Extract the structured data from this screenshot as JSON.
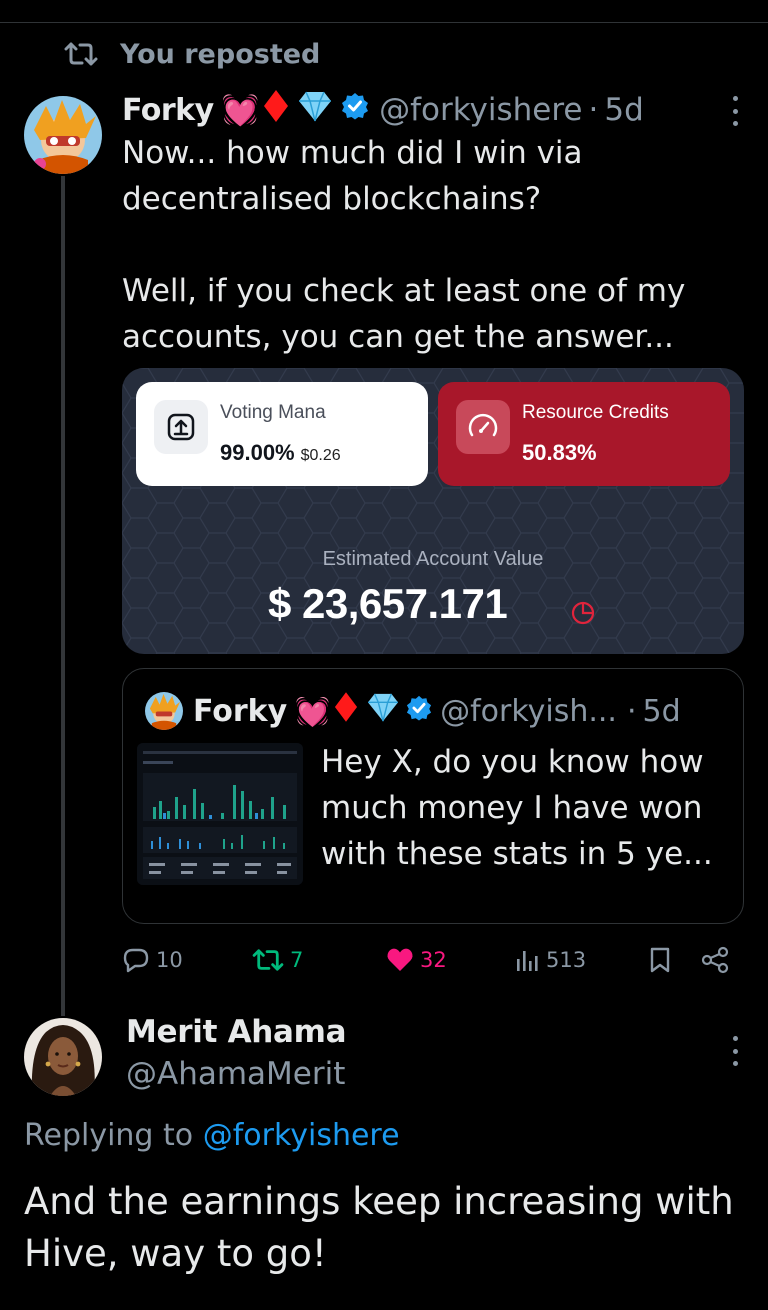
{
  "repost": {
    "label": "You reposted",
    "icon": "repost-icon"
  },
  "tweet": {
    "author_name": "Forky",
    "emoji_heart": "💓",
    "emoji_diamond_red": "♦",
    "emoji_gem": "💎",
    "handle": "@forkyishere",
    "separator": "·",
    "age": "5d",
    "text_lines": [
      "Now... how much did I win via",
      "decentralised blockchains?",
      "",
      "Well, if you check at least one of my",
      "accounts, you can get the answer..."
    ],
    "media": {
      "voting_mana": {
        "label": "Voting Mana",
        "value": "99.00%",
        "usd": "$0.26"
      },
      "resource_credits": {
        "label": "Resource Credits",
        "value": "50.83%"
      },
      "estimated_label": "Estimated Account Value",
      "estimated_value": "$ 23,657.171"
    },
    "quote": {
      "author_name": "Forky",
      "handle": "@forkyish...",
      "separator": "·",
      "age": "5d",
      "text_lines": [
        "Hey X, do you know how",
        "much money I have won",
        "with these stats in 5 ye..."
      ]
    },
    "actions": {
      "replies": "10",
      "reposts": "7",
      "likes": "32",
      "views": "513"
    }
  },
  "reply": {
    "author_name": "Merit Ahama",
    "handle": "@AhamaMerit",
    "replying_prefix": "Replying to",
    "replying_to": "@forkyishere",
    "text_lines": [
      "And the earnings keep increasing with",
      "Hive, way to go!"
    ]
  },
  "colors": {
    "background": "#000000",
    "accent_blue": "#1d9bf0",
    "repost_green": "#00ba7c",
    "like_pink": "#f91880",
    "muted": "#8b98a5",
    "resource_red": "#a8172a"
  }
}
